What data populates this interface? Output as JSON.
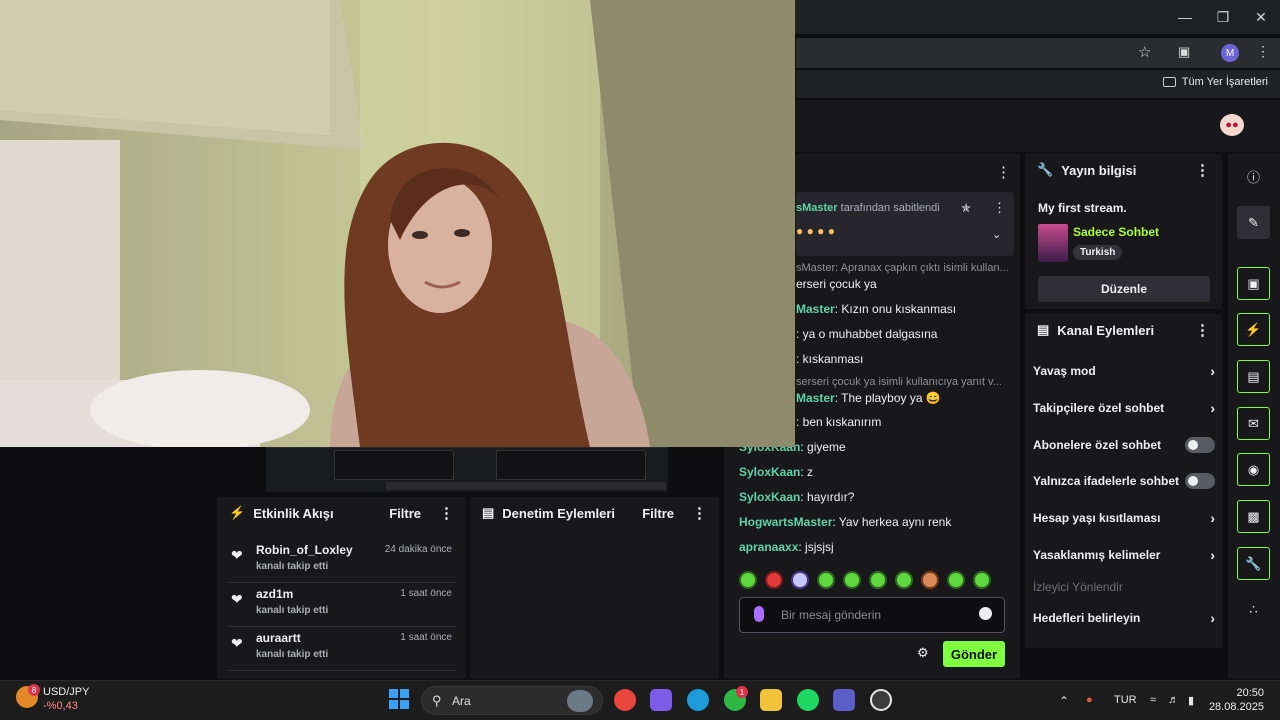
{
  "browser": {
    "bookmarks_label": "Tüm Yer İşaretleri",
    "profile_initial": "M"
  },
  "events": {
    "title": "Etkinlik Akışı",
    "filter": "Filtre",
    "items": [
      {
        "name": "Robin_of_Loxley",
        "time": "24 dakika önce",
        "desc": "kanalı takip etti"
      },
      {
        "name": "azd1m",
        "time": "1 saat önce",
        "desc": "kanalı takip etti"
      },
      {
        "name": "auraartt",
        "time": "1 saat önce",
        "desc": "kanalı takip etti"
      }
    ]
  },
  "mod": {
    "title": "Denetim Eylemleri",
    "filter": "Filtre"
  },
  "chat": {
    "pinned_by": "sMaster",
    "pinned_suffix": " tarafından sabitlendi",
    "lines": [
      {
        "type": "sys",
        "text": "sMaster: Apranax çapkın çıktı isimli kullan..."
      },
      {
        "type": "plain",
        "text": "erseri çocuk ya"
      },
      {
        "type": "user",
        "user": "Master",
        "text": ": Kızın onu kıskanması"
      },
      {
        "type": "plain",
        "text": ": ya o muhabbet dalgasına"
      },
      {
        "type": "plain",
        "text": ": kıskanması"
      },
      {
        "type": "sys",
        "text": "serseri çocuk ya isimli kullanıcıya yanıt v..."
      },
      {
        "type": "user",
        "user": "Master",
        "text": ": The playboy ya 😄"
      },
      {
        "type": "plain",
        "text": ": ben kıskanırım"
      },
      {
        "type": "user",
        "user": "SyloxKaan",
        "text": ": giyeme"
      },
      {
        "type": "user",
        "user": "SyloxKaan",
        "text": ": z"
      },
      {
        "type": "user",
        "user": "SyloxKaan",
        "text": ": hayırdır?"
      },
      {
        "type": "user",
        "user": "HogwartsMaster",
        "text": ": Yav herkea aynı renk"
      },
      {
        "type": "user",
        "user": "apranaaxx",
        "text": ": jsjsjsj"
      }
    ],
    "placeholder": "Bir mesaj gönderin",
    "send": "Gönder"
  },
  "info": {
    "title": "Yayın bilgisi",
    "stream_title": "My first stream.",
    "category": "Sadece Sohbet",
    "tag": "Turkish",
    "edit": "Düzenle"
  },
  "actions": {
    "title": "Kanal Eylemleri",
    "items": [
      {
        "label": "Yavaş mod",
        "kind": "chevron"
      },
      {
        "label": "Takipçilere özel sohbet",
        "kind": "chevron"
      },
      {
        "label": "Abonelere özel sohbet",
        "kind": "toggle"
      },
      {
        "label": "Yalnızca ifadelerle sohbet",
        "kind": "toggle"
      },
      {
        "label": "Hesap yaşı kısıtlaması",
        "kind": "chevron"
      },
      {
        "label": "Yasaklanmış kelimeler",
        "kind": "chevron"
      },
      {
        "label": "İzleyici Yönlendir",
        "kind": "disabled"
      },
      {
        "label": "Hedefleri belirleyin",
        "kind": "chevron"
      }
    ]
  },
  "taskbar": {
    "ticker": "USD/JPY",
    "ticker_change": "-%0,43",
    "ticker_badge": "8",
    "search": "Ara",
    "lang": "TUR",
    "time": "20:50",
    "date": "28.08.2025",
    "notif_badge": "1"
  },
  "colors": {
    "accent": "#7fff3f",
    "chat_user": "#5fd3a7",
    "category": "#adff2f"
  }
}
